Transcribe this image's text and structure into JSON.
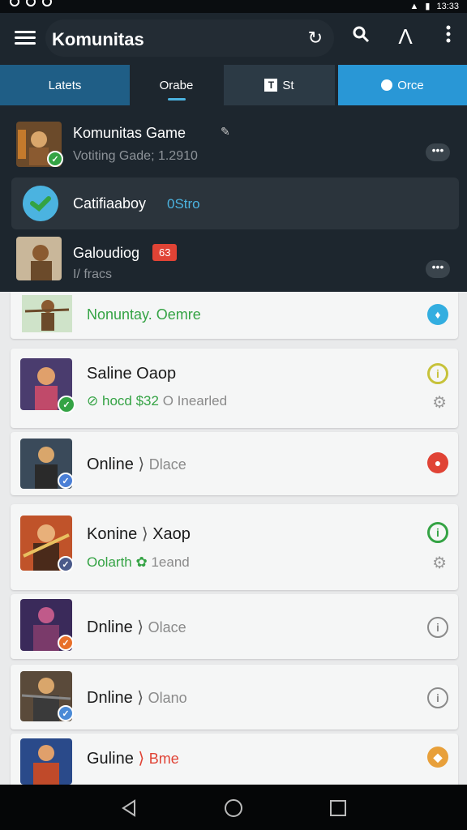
{
  "status_bar": {
    "time": "13:33"
  },
  "app_bar": {
    "title": "Komunitas",
    "refresh_icon": "refresh-icon",
    "search_icon": "search-icon",
    "filter_icon": "lambda-icon",
    "more_icon": "more-vert-icon"
  },
  "tabs": [
    {
      "label": "Latets"
    },
    {
      "label": "Orabe"
    },
    {
      "label": "St"
    },
    {
      "label": "Orce"
    }
  ],
  "top_list": [
    {
      "title": "Komunitas Game",
      "subtitle": "Votiting Gade; 1.2910"
    },
    {
      "title": "Catifiaaboy",
      "tag": "0Stro"
    },
    {
      "title": "Galoudiog",
      "badge": "63",
      "subtitle": "I/ fracs"
    }
  ],
  "cards": [
    {
      "title": "",
      "subtitle": "Nonuntay. Oemre"
    },
    {
      "title": "Saline Oaop",
      "subtitle_a": "hocd",
      "subtitle_b": "$32",
      "subtitle_c": "O Inearled"
    },
    {
      "title": "Online",
      "subtitle": "Dlace"
    },
    {
      "title": "Konine",
      "title_b": "Xaop",
      "subtitle_a": "Oolarth",
      "subtitle_c": "1eand"
    },
    {
      "title": "Dnline",
      "subtitle": "Olace"
    },
    {
      "title": "Dnline",
      "subtitle": "Olano"
    },
    {
      "title": "Guline",
      "subtitle": "Bme"
    }
  ],
  "colors": {
    "dark_bg": "#1d262e",
    "tab_active": "#2997d6",
    "green": "#34a344",
    "red": "#e04335",
    "orange": "#e8883a"
  }
}
